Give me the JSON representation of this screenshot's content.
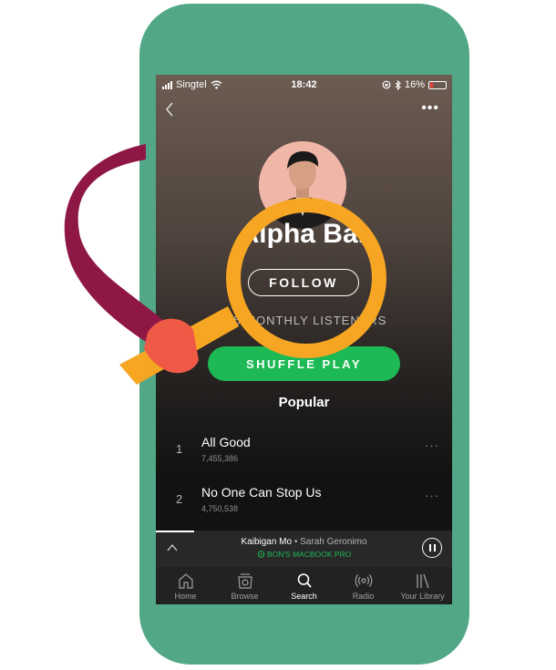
{
  "status_bar": {
    "carrier": "Singtel",
    "time": "18:42",
    "battery": "16%",
    "battery_level": 0.16
  },
  "artist": {
    "name": "Alpha Bar",
    "follow_label": "FOLLOW",
    "monthly_listeners": "...5 MONTHLY LISTENERS"
  },
  "shuffle_label": "SHUFFLE PLAY",
  "section_title": "Popular",
  "tracks": [
    {
      "number": "1",
      "title": "All Good",
      "plays": "7,455,386"
    },
    {
      "number": "2",
      "title": "No One Can Stop Us",
      "plays": "4,750,538"
    }
  ],
  "now_playing": {
    "title": "Kaibigan Mo",
    "artist": "Sarah Geronimo",
    "separator": " • ",
    "device": "BON'S MACBOOK PRO",
    "progress": 0.13
  },
  "tabs": [
    {
      "label": "Home",
      "icon": "home-icon"
    },
    {
      "label": "Browse",
      "icon": "browse-icon"
    },
    {
      "label": "Search",
      "icon": "search-icon"
    },
    {
      "label": "Radio",
      "icon": "radio-icon"
    },
    {
      "label": "Your Library",
      "icon": "library-icon"
    }
  ],
  "colors": {
    "accent": "#1db954",
    "phone": "#52a886",
    "magnifier": "#f6a623",
    "arm": "#8e1745",
    "hand": "#ef5a46"
  }
}
